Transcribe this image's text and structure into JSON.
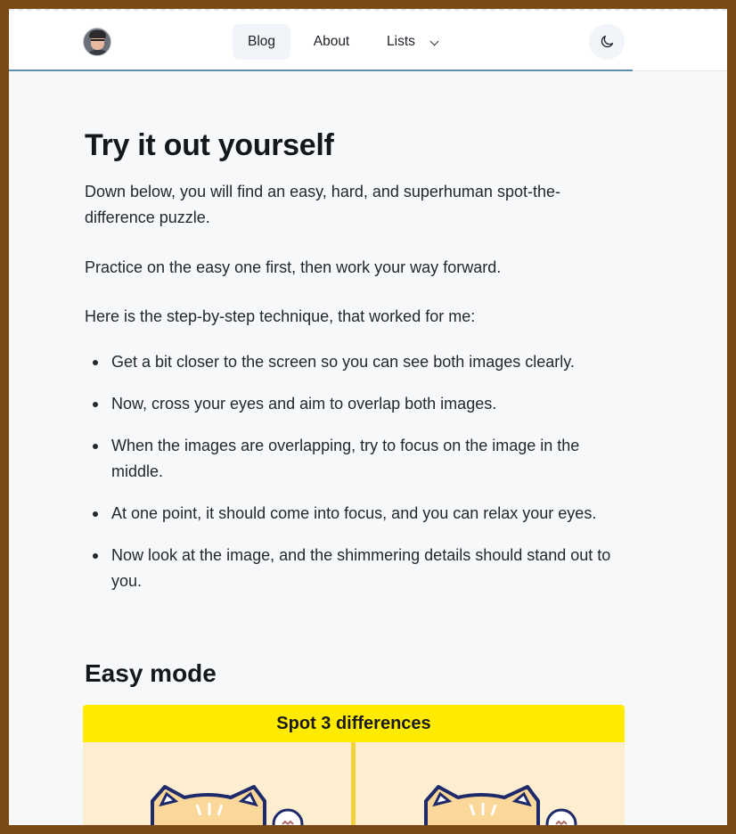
{
  "nav": {
    "blog_label": "Blog",
    "about_label": "About",
    "lists_label": "Lists"
  },
  "article": {
    "heading": "Try it out yourself",
    "paragraphs": [
      "Down below, you will find an easy, hard, and superhuman spot-the-difference puzzle.",
      "Practice on the easy one first, then work your way forward.",
      "Here is the step-by-step technique, that worked for me:"
    ],
    "steps": [
      "Get a bit closer to the screen so you can see both images clearly.",
      "Now, cross your eyes and aim to overlap both images.",
      "When the images are overlapping, try to focus on the image in the middle.",
      "At one point, it should come into focus, and you can relax your eyes.",
      "Now look at the image, and the shimmering details should stand out to you."
    ],
    "section_heading": "Easy mode"
  },
  "puzzle": {
    "banner": "Spot 3 differences"
  },
  "colors": {
    "accent_line": "#5b8fad",
    "puzzle_banner": "#ffeb00",
    "puzzle_bg": "#fdeed2"
  }
}
